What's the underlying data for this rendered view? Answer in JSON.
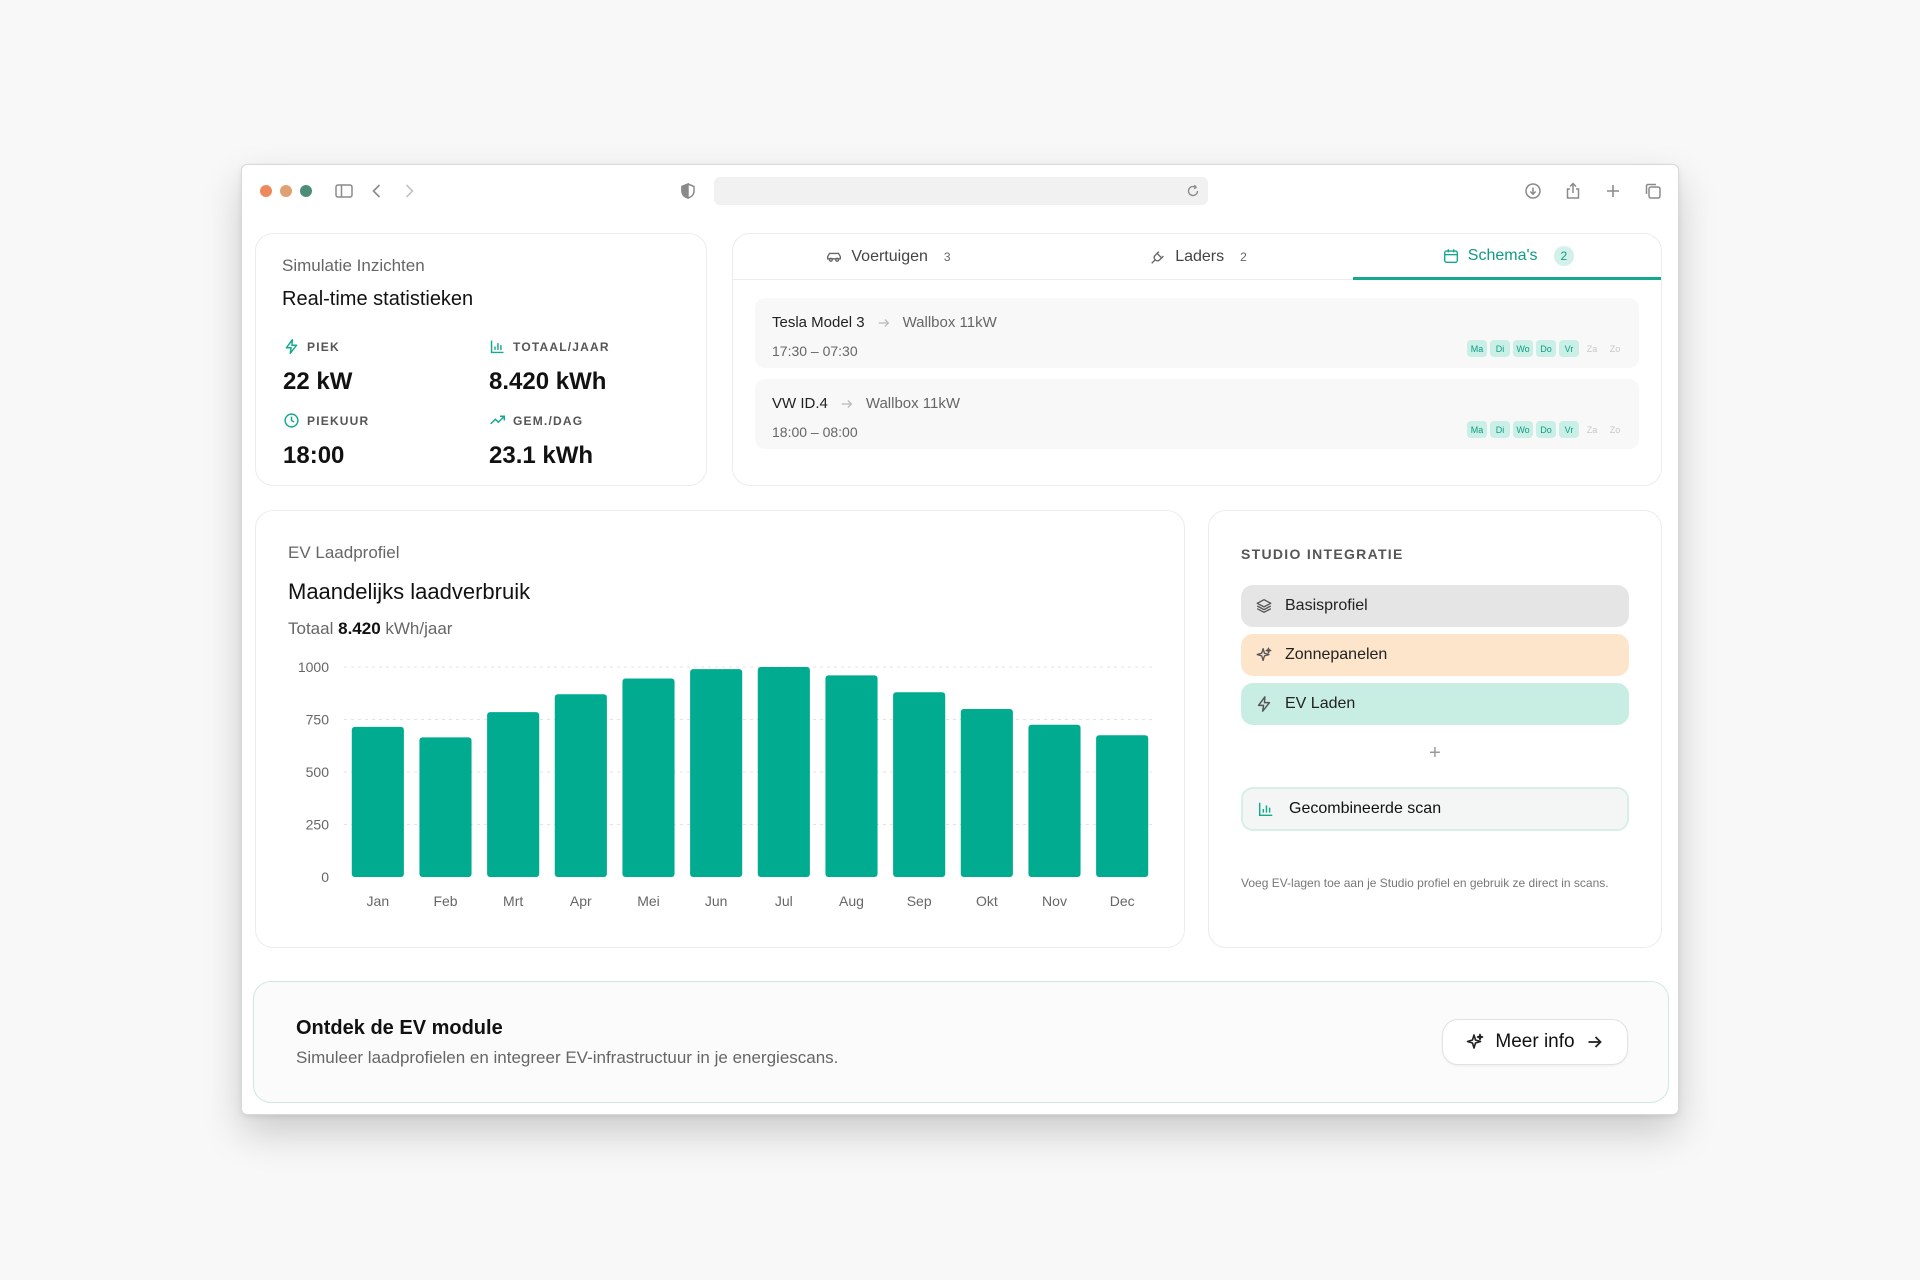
{
  "browser": {
    "traffic_lights": [
      "#ec8a5c",
      "#e0a072",
      "#4e8c79"
    ],
    "url": ""
  },
  "insights": {
    "title": "Simulatie Inzichten",
    "subtitle": "Real-time statistieken",
    "stats": [
      {
        "icon": "bolt-icon",
        "label": "PIEK",
        "value": "22 kW"
      },
      {
        "icon": "bar-chart-icon",
        "label": "TOTAAL/JAAR",
        "value": "8.420 kWh"
      },
      {
        "icon": "clock-icon",
        "label": "PIEKUUR",
        "value": "18:00"
      },
      {
        "icon": "trend-up-icon",
        "label": "GEM./DAG",
        "value": "23.1 kWh"
      }
    ]
  },
  "tabs": [
    {
      "icon": "car-icon",
      "label": "Voertuigen",
      "count": "3",
      "active": false
    },
    {
      "icon": "plug-icon",
      "label": "Laders",
      "count": "2",
      "active": false
    },
    {
      "icon": "calendar-icon",
      "label": "Schema's",
      "count": "2",
      "active": true
    }
  ],
  "schedules": [
    {
      "vehicle": "Tesla Model 3",
      "charger": "Wallbox 11kW",
      "time": "17:30 – 07:30",
      "days": [
        {
          "d": "Ma",
          "on": true
        },
        {
          "d": "Di",
          "on": true
        },
        {
          "d": "Wo",
          "on": true
        },
        {
          "d": "Do",
          "on": true
        },
        {
          "d": "Vr",
          "on": true
        },
        {
          "d": "Za",
          "on": false
        },
        {
          "d": "Zo",
          "on": false
        }
      ]
    },
    {
      "vehicle": "VW ID.4",
      "charger": "Wallbox 11kW",
      "time": "18:00 – 08:00",
      "days": [
        {
          "d": "Ma",
          "on": true
        },
        {
          "d": "Di",
          "on": true
        },
        {
          "d": "Wo",
          "on": true
        },
        {
          "d": "Do",
          "on": true
        },
        {
          "d": "Vr",
          "on": true
        },
        {
          "d": "Za",
          "on": false
        },
        {
          "d": "Zo",
          "on": false
        }
      ]
    }
  ],
  "profile": {
    "section": "EV Laadprofiel",
    "title": "Maandelijks laadverbruik",
    "total_prefix": "Totaal",
    "total_value": "8.420",
    "total_unit": "kWh/jaar"
  },
  "chart_data": {
    "type": "bar",
    "categories": [
      "Jan",
      "Feb",
      "Mrt",
      "Apr",
      "Mei",
      "Jun",
      "Jul",
      "Aug",
      "Sep",
      "Okt",
      "Nov",
      "Dec"
    ],
    "values": [
      715,
      665,
      785,
      870,
      945,
      990,
      1000,
      960,
      880,
      800,
      725,
      675
    ],
    "ylim": [
      0,
      1000
    ],
    "yticks": [
      0,
      250,
      500,
      750,
      1000
    ],
    "grid": true,
    "color": "#00ab90",
    "title": "",
    "xlabel": "",
    "ylabel": ""
  },
  "studio": {
    "title": "STUDIO INTEGRATIE",
    "layers": [
      {
        "icon": "layers-icon",
        "label": "Basisprofiel",
        "bg": "#e5e5e5"
      },
      {
        "icon": "sparkle-icon",
        "label": "Zonnepanelen",
        "bg": "#fde5cc"
      },
      {
        "icon": "bolt-icon",
        "label": "EV Laden",
        "bg": "#c8eee4"
      }
    ],
    "add_symbol": "+",
    "scan_label": "Gecombineerde scan",
    "note": "Voeg EV-lagen toe aan je Studio profiel en gebruik ze direct in scans."
  },
  "banner": {
    "title": "Ontdek de EV module",
    "text": "Simuleer laadprofielen en integreer EV-infrastructuur in je energiescans.",
    "button": "Meer info"
  }
}
